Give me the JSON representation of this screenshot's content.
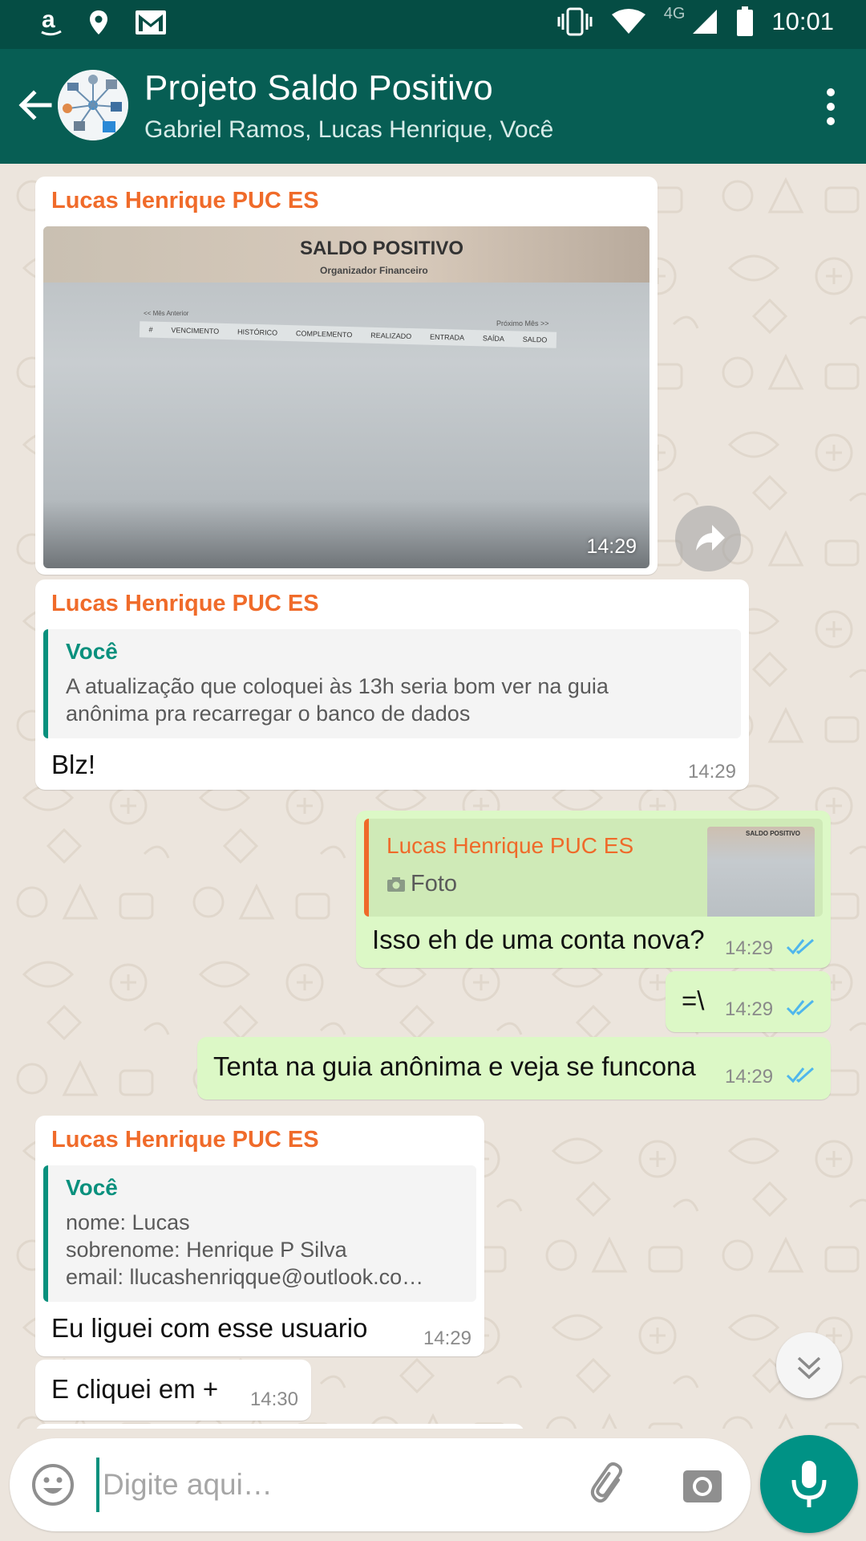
{
  "status_bar": {
    "time": "10:01",
    "network": "4G"
  },
  "header": {
    "title": "Projeto Saldo Positivo",
    "subtitle": "Gabriel Ramos, Lucas Henrique, Você"
  },
  "messages": [
    {
      "sender": "Lucas Henrique PUC ES",
      "type": "photo",
      "time": "14:29",
      "photo": {
        "title": "SALDO POSITIVO",
        "subtitle": "Organizador Financeiro",
        "prev": "<< Mês Anterior",
        "next": "Próximo Mês >>",
        "columns": [
          "#",
          "VENCIMENTO",
          "HISTÓRICO",
          "COMPLEMENTO",
          "REALIZADO",
          "ENTRADA",
          "SAÍDA",
          "SALDO"
        ]
      }
    },
    {
      "sender": "Lucas Henrique PUC ES",
      "quote_author": "Você",
      "quote_lines": [
        "A atualização que coloquei às 13h seria bom ver na guia",
        "anônima pra recarregar o banco de dados"
      ],
      "text": "Blz!",
      "time": "14:29"
    },
    {
      "outgoing": true,
      "quote_author": "Lucas Henrique PUC ES",
      "quote_text": "Foto",
      "thumb_title": "SALDO POSITIVO",
      "text": "Isso eh de uma conta nova?",
      "time": "14:29"
    },
    {
      "outgoing": true,
      "text": "=\\",
      "time": "14:29"
    },
    {
      "outgoing": true,
      "text": "Tenta na guia anônima e veja se funcona",
      "time": "14:29"
    },
    {
      "sender": "Lucas Henrique PUC ES",
      "quote_author": "Você",
      "quote_lines": [
        "nome: Lucas",
        "sobrenome: Henrique P Silva",
        "email: llucashenriqque@outlook.co…"
      ],
      "text": "Eu liguei com  esse usuario",
      "time": "14:29"
    },
    {
      "text": "E cliquei em +",
      "time": "14:30"
    }
  ],
  "input": {
    "placeholder": "Digite aqui…"
  },
  "colors": {
    "header": "#075e54",
    "status_bar": "#054d44",
    "sender_name": "#f06b2a",
    "quote_accent": "#09907d",
    "outgoing_bubble": "#dcf8c6",
    "read_ticks": "#4fb6ec",
    "mic_button": "#009285"
  },
  "icons": {
    "status_left": [
      "amazon-icon",
      "location-icon",
      "gmail-icon"
    ],
    "status_right": [
      "vibrate-icon",
      "wifi-icon",
      "signal-icon",
      "battery-icon"
    ],
    "header": [
      "back-arrow-icon",
      "more-vert-icon"
    ],
    "input": [
      "emoji-icon",
      "attach-icon",
      "camera-icon",
      "mic-icon"
    ]
  }
}
